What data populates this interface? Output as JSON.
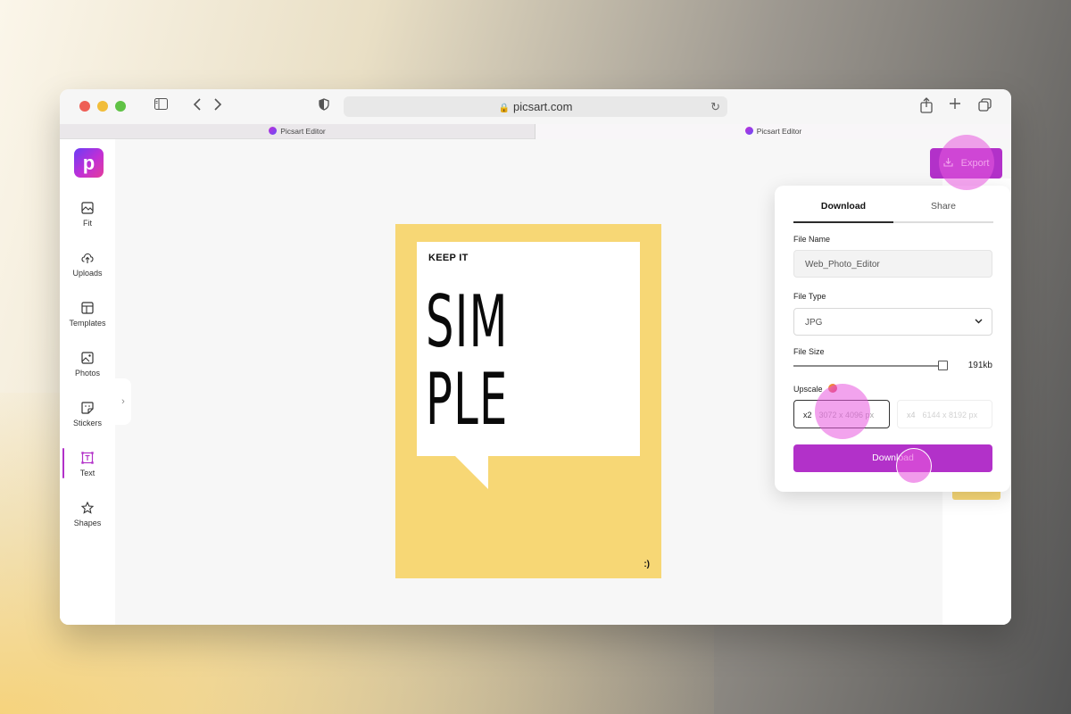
{
  "browser": {
    "url": "picsart.com",
    "tabs": [
      {
        "label": "Picsart Editor"
      },
      {
        "label": "Picsart Editor"
      }
    ]
  },
  "app": {
    "logo_letter": "p",
    "sidebar": {
      "items": [
        {
          "label": "Fit",
          "icon": "fit-icon"
        },
        {
          "label": "Uploads",
          "icon": "upload-cloud-icon"
        },
        {
          "label": "Templates",
          "icon": "templates-icon"
        },
        {
          "label": "Photos",
          "icon": "photos-icon"
        },
        {
          "label": "Stickers",
          "icon": "stickers-icon"
        },
        {
          "label": "Text",
          "icon": "text-icon",
          "active": true
        },
        {
          "label": "Shapes",
          "icon": "star-icon"
        }
      ]
    },
    "export_button": "Export"
  },
  "canvas": {
    "top_text": "KEEP IT",
    "line1": "SIM",
    "line2": "PLE",
    "corner_text": ":)",
    "poster_color": "#f7d775"
  },
  "export_panel": {
    "tabs": [
      "Download",
      "Share"
    ],
    "active_tab": "Download",
    "file_name_label": "File Name",
    "file_name_value": "Web_Photo_Editor",
    "file_type_label": "File Type",
    "file_type_value": "JPG",
    "file_size_label": "File Size",
    "file_size_value": "191kb",
    "file_size_level": 0.97,
    "upscale_label": "Upscale",
    "upscale_options": [
      {
        "factor": "x2",
        "dims": "3072 x 4096 px",
        "selected": true
      },
      {
        "factor": "x4",
        "dims": "6144 x 8192 px",
        "selected": false
      }
    ],
    "download_button": "Download"
  },
  "colors": {
    "accent": "#b231c9",
    "poster_yellow": "#f7d775",
    "click_highlight": "#e858de"
  }
}
